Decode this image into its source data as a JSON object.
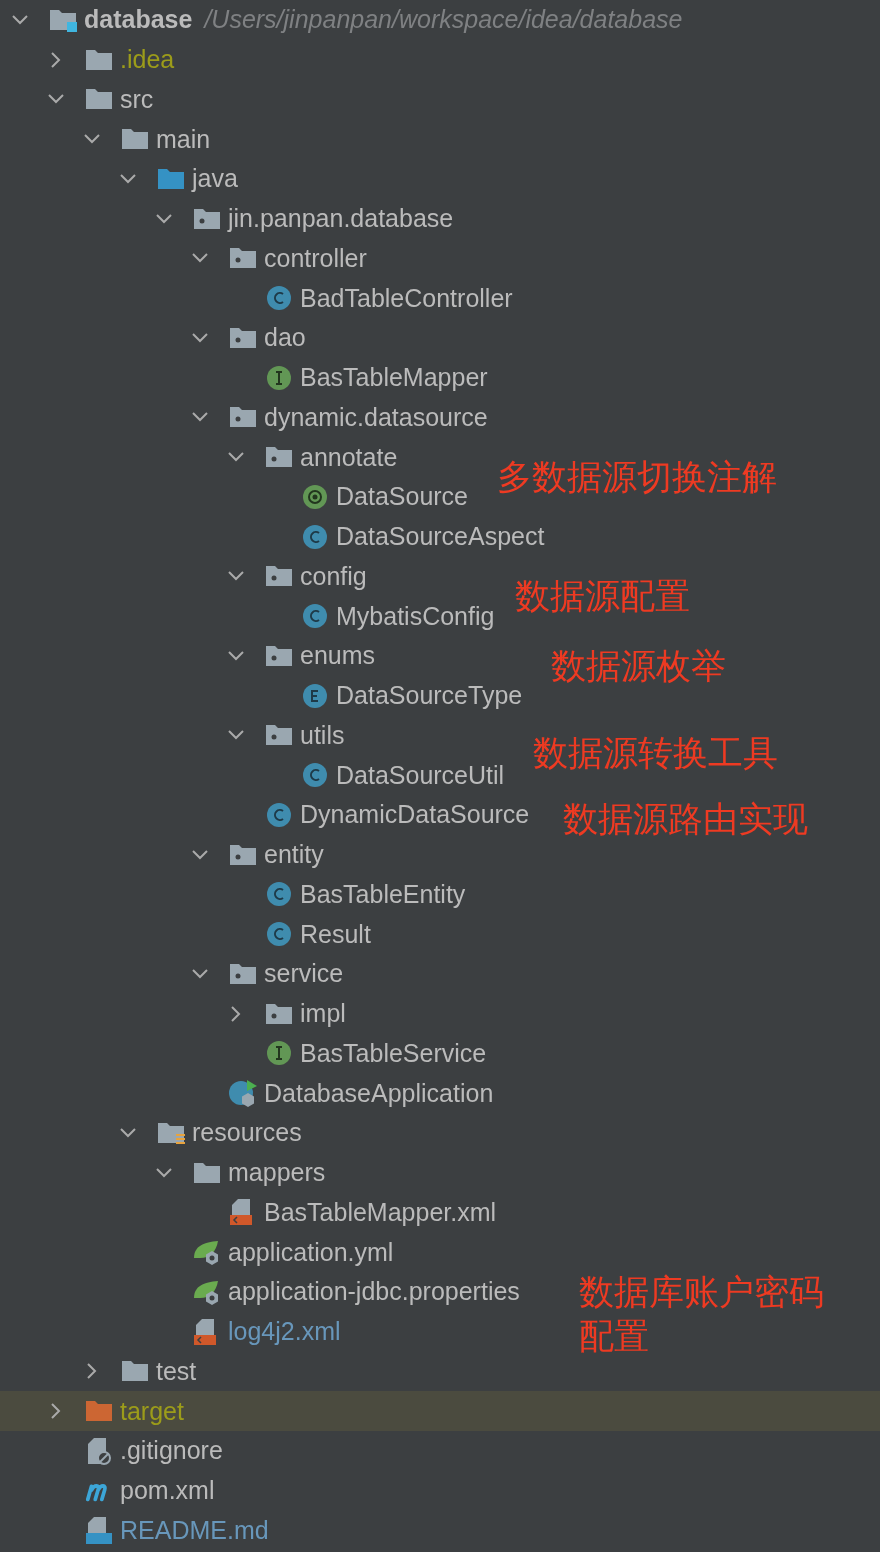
{
  "tree": [
    {
      "name": "database",
      "path": "/Users/jinpanpan/workspace/idea/database",
      "kind": "module",
      "expanded": true,
      "highlighted": false,
      "ignored": false,
      "added": false,
      "children": [
        {
          "name": ".idea",
          "kind": "folder",
          "expanded": false,
          "highlighted": false,
          "ignored": true,
          "added": false
        },
        {
          "name": "src",
          "kind": "folder",
          "expanded": true,
          "highlighted": false,
          "ignored": false,
          "added": false,
          "children": [
            {
              "name": "main",
              "kind": "folder",
              "expanded": true,
              "highlighted": false,
              "ignored": false,
              "added": false,
              "children": [
                {
                  "name": "java",
                  "kind": "source-folder",
                  "expanded": true,
                  "highlighted": false,
                  "ignored": false,
                  "added": false,
                  "children": [
                    {
                      "name": "jin.panpan.database",
                      "kind": "package",
                      "expanded": true,
                      "highlighted": false,
                      "ignored": false,
                      "added": false,
                      "children": [
                        {
                          "name": "controller",
                          "kind": "package",
                          "expanded": true,
                          "highlighted": false,
                          "ignored": false,
                          "added": false,
                          "children": [
                            {
                              "name": "BadTableController",
                              "kind": "class",
                              "highlighted": false,
                              "ignored": false,
                              "added": false
                            }
                          ]
                        },
                        {
                          "name": "dao",
                          "kind": "package",
                          "expanded": true,
                          "highlighted": false,
                          "ignored": false,
                          "added": false,
                          "children": [
                            {
                              "name": "BasTableMapper",
                              "kind": "interface",
                              "highlighted": false,
                              "ignored": false,
                              "added": false
                            }
                          ]
                        },
                        {
                          "name": "dynamic.datasource",
                          "kind": "package",
                          "expanded": true,
                          "highlighted": false,
                          "ignored": false,
                          "added": false,
                          "children": [
                            {
                              "name": "annotate",
                              "kind": "package",
                              "expanded": true,
                              "highlighted": false,
                              "ignored": false,
                              "added": false,
                              "children": [
                                {
                                  "name": "DataSource",
                                  "kind": "annotation",
                                  "highlighted": false,
                                  "ignored": false,
                                  "added": false,
                                  "note": "多数据源切换注解"
                                },
                                {
                                  "name": "DataSourceAspect",
                                  "kind": "class",
                                  "highlighted": false,
                                  "ignored": false,
                                  "added": false
                                }
                              ]
                            },
                            {
                              "name": "config",
                              "kind": "package",
                              "expanded": true,
                              "highlighted": false,
                              "ignored": false,
                              "added": false,
                              "children": [
                                {
                                  "name": "MybatisConfig",
                                  "kind": "class",
                                  "highlighted": false,
                                  "ignored": false,
                                  "added": false,
                                  "note": "数据源配置"
                                }
                              ]
                            },
                            {
                              "name": "enums",
                              "kind": "package",
                              "expanded": true,
                              "highlighted": false,
                              "ignored": false,
                              "added": false,
                              "children": [
                                {
                                  "name": "DataSourceType",
                                  "kind": "enum",
                                  "highlighted": false,
                                  "ignored": false,
                                  "added": false,
                                  "note": "数据源枚举"
                                }
                              ]
                            },
                            {
                              "name": "utils",
                              "kind": "package",
                              "expanded": true,
                              "highlighted": false,
                              "ignored": false,
                              "added": false,
                              "children": [
                                {
                                  "name": "DataSourceUtil",
                                  "kind": "class",
                                  "highlighted": false,
                                  "ignored": false,
                                  "added": false,
                                  "note": "数据源转换工具"
                                }
                              ]
                            },
                            {
                              "name": "DynamicDataSource",
                              "kind": "class",
                              "highlighted": false,
                              "ignored": false,
                              "added": false,
                              "note": "数据源路由实现"
                            }
                          ]
                        },
                        {
                          "name": "entity",
                          "kind": "package",
                          "expanded": true,
                          "highlighted": false,
                          "ignored": false,
                          "added": false,
                          "children": [
                            {
                              "name": "BasTableEntity",
                              "kind": "class",
                              "highlighted": false,
                              "ignored": false,
                              "added": false
                            },
                            {
                              "name": "Result",
                              "kind": "class",
                              "highlighted": false,
                              "ignored": false,
                              "added": false
                            }
                          ]
                        },
                        {
                          "name": "service",
                          "kind": "package",
                          "expanded": true,
                          "highlighted": false,
                          "ignored": false,
                          "added": false,
                          "children": [
                            {
                              "name": "impl",
                              "kind": "package",
                              "expanded": false,
                              "highlighted": false,
                              "ignored": false,
                              "added": false
                            },
                            {
                              "name": "BasTableService",
                              "kind": "interface",
                              "highlighted": false,
                              "ignored": false,
                              "added": false
                            }
                          ]
                        },
                        {
                          "name": "DatabaseApplication",
                          "kind": "spring-boot-class",
                          "highlighted": false,
                          "ignored": false,
                          "added": false
                        }
                      ]
                    }
                  ]
                },
                {
                  "name": "resources",
                  "kind": "resources-folder",
                  "expanded": true,
                  "highlighted": false,
                  "ignored": false,
                  "added": false,
                  "children": [
                    {
                      "name": "mappers",
                      "kind": "folder",
                      "expanded": true,
                      "highlighted": false,
                      "ignored": false,
                      "added": false,
                      "children": [
                        {
                          "name": "BasTableMapper.xml",
                          "kind": "xml",
                          "highlighted": false,
                          "ignored": false,
                          "added": false
                        }
                      ]
                    },
                    {
                      "name": "application.yml",
                      "kind": "spring-config",
                      "highlighted": false,
                      "ignored": false,
                      "added": false
                    },
                    {
                      "name": "application-jdbc.properties",
                      "kind": "spring-config",
                      "highlighted": false,
                      "ignored": false,
                      "added": false,
                      "note": "数据库账户密码配置"
                    },
                    {
                      "name": "log4j2.xml",
                      "kind": "xml",
                      "highlighted": false,
                      "ignored": false,
                      "added": true
                    }
                  ]
                }
              ]
            },
            {
              "name": "test",
              "kind": "folder",
              "expanded": false,
              "highlighted": false,
              "ignored": false,
              "added": false
            }
          ]
        },
        {
          "name": "target",
          "kind": "excluded-folder",
          "expanded": false,
          "highlighted": true,
          "ignored": true,
          "added": false
        },
        {
          "name": ".gitignore",
          "kind": "gitignore",
          "highlighted": false,
          "ignored": false,
          "added": false
        },
        {
          "name": "pom.xml",
          "kind": "maven",
          "highlighted": false,
          "ignored": false,
          "added": false
        },
        {
          "name": "README.md",
          "kind": "markdown",
          "highlighted": false,
          "ignored": false,
          "added": true
        }
      ]
    }
  ]
}
